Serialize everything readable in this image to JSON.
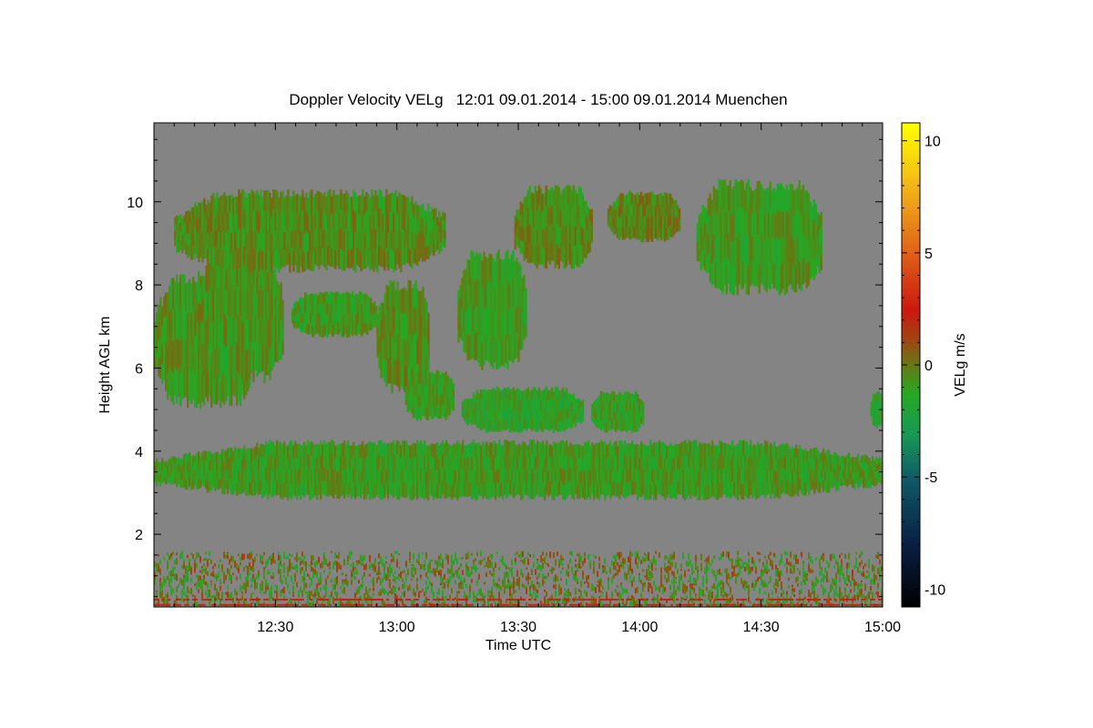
{
  "chart_data": {
    "type": "heatmap",
    "title": "Doppler Velocity VELg   12:01 09.01.2014 - 15:00 09.01.2014 Muenchen",
    "xlabel": "Time UTC",
    "ylabel": "Height AGL km",
    "colorbar_label": "VELg m/s",
    "x_range_minutes": [
      0,
      180
    ],
    "x_start": "12:01",
    "x_end": "15:00",
    "xlim": [
      "12:01",
      "15:00"
    ],
    "ylim": [
      0.25,
      11.9
    ],
    "x_ticks": [
      {
        "label": "12:30",
        "minutes": 30
      },
      {
        "label": "13:00",
        "minutes": 60
      },
      {
        "label": "13:30",
        "minutes": 90
      },
      {
        "label": "14:00",
        "minutes": 120
      },
      {
        "label": "14:30",
        "minutes": 150
      },
      {
        "label": "15:00",
        "minutes": 180
      }
    ],
    "y_ticks": [
      {
        "label": "2",
        "value": 2
      },
      {
        "label": "4",
        "value": 4
      },
      {
        "label": "6",
        "value": 6
      },
      {
        "label": "8",
        "value": 8
      },
      {
        "label": "10",
        "value": 10
      }
    ],
    "colorbar_ticks": [
      {
        "label": "10",
        "value": 10
      },
      {
        "label": "5",
        "value": 5
      },
      {
        "label": "0",
        "value": 0
      },
      {
        "label": "-5",
        "value": -5
      },
      {
        "label": "-10",
        "value": -10
      }
    ],
    "colorbar_range": [
      -10.8,
      10.8
    ],
    "background_color": "#848484",
    "colormap": [
      {
        "v": -10.8,
        "c": "#000000"
      },
      {
        "v": -8,
        "c": "#0a1e44"
      },
      {
        "v": -5,
        "c": "#0f5b67"
      },
      {
        "v": -3,
        "c": "#189a55"
      },
      {
        "v": -1.2,
        "c": "#26a822"
      },
      {
        "v": 0,
        "c": "#647a14"
      },
      {
        "v": 1.2,
        "c": "#a04410"
      },
      {
        "v": 2.5,
        "c": "#cc1810"
      },
      {
        "v": 5,
        "c": "#e06018"
      },
      {
        "v": 8,
        "c": "#f4b418"
      },
      {
        "v": 10.8,
        "c": "#ffff00"
      }
    ],
    "echo_regions": [
      {
        "name": "low-level cloud layer",
        "t": [
          0,
          180
        ],
        "h": [
          2.9,
          4.2
        ],
        "velocity_ms": -0.8
      },
      {
        "name": "mid-level cloud 1",
        "t": [
          0,
          25
        ],
        "h": [
          5.2,
          8.2
        ],
        "velocity_ms": -0.7
      },
      {
        "name": "mid-level cloud 2",
        "t": [
          10,
          32
        ],
        "h": [
          5.8,
          8.6
        ],
        "velocity_ms": -0.6
      },
      {
        "name": "mid-level cloud 3",
        "t": [
          34,
          55
        ],
        "h": [
          6.8,
          7.8
        ],
        "velocity_ms": -0.8
      },
      {
        "name": "mid-level cloud 4",
        "t": [
          55,
          68
        ],
        "h": [
          5.5,
          8.0
        ],
        "velocity_ms": -0.5
      },
      {
        "name": "mid-level cloud 5",
        "t": [
          62,
          74
        ],
        "h": [
          4.8,
          5.9
        ],
        "velocity_ms": -0.9
      },
      {
        "name": "mid-level cloud 6",
        "t": [
          75,
          92
        ],
        "h": [
          6.1,
          8.7
        ],
        "velocity_ms": -0.8
      },
      {
        "name": "mid-level cloud 7",
        "t": [
          76,
          106
        ],
        "h": [
          4.5,
          5.5
        ],
        "velocity_ms": -1.2
      },
      {
        "name": "mid-level cloud 8",
        "t": [
          108,
          121
        ],
        "h": [
          4.5,
          5.4
        ],
        "velocity_ms": -0.9
      },
      {
        "name": "upper cloud 1",
        "t": [
          5,
          72
        ],
        "h": [
          8.4,
          10.2
        ],
        "velocity_ms": -0.4
      },
      {
        "name": "upper cloud 2",
        "t": [
          89,
          108
        ],
        "h": [
          8.5,
          10.3
        ],
        "velocity_ms": -0.3
      },
      {
        "name": "upper cloud 3",
        "t": [
          112,
          130
        ],
        "h": [
          9.1,
          10.2
        ],
        "velocity_ms": -0.2
      },
      {
        "name": "upper cloud 4",
        "t": [
          134,
          165
        ],
        "h": [
          7.9,
          10.4
        ],
        "velocity_ms": -0.8
      },
      {
        "name": "upper cloud 5",
        "t": [
          177,
          180
        ],
        "h": [
          4.6,
          5.4
        ],
        "velocity_ms": -1.4
      },
      {
        "name": "boundary layer",
        "t": [
          0,
          180
        ],
        "h": [
          0.25,
          1.6
        ],
        "velocity_ms": -0.2
      }
    ]
  }
}
